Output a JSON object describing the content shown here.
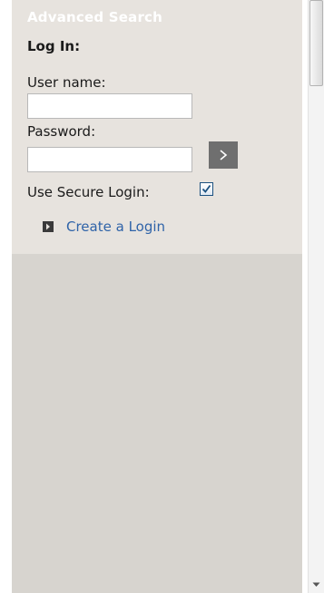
{
  "sidebar": {
    "advanced_search_label": "Advanced Search",
    "login": {
      "title": "Log In:",
      "username_label": "User name:",
      "username_value": "",
      "password_label": "Password:",
      "password_value": "",
      "submit_icon": "chevron-right-icon",
      "secure_login_label": "Use Secure Login:",
      "secure_login_checked": true,
      "create_login_label": "Create a Login"
    }
  },
  "colors": {
    "panel_bg": "#d7d4cf",
    "login_box_bg": "#e7e3de",
    "link": "#2f63a8",
    "button_bg": "#6f6f6f"
  },
  "scrollbar": {
    "down_icon": "arrow-down-icon"
  }
}
